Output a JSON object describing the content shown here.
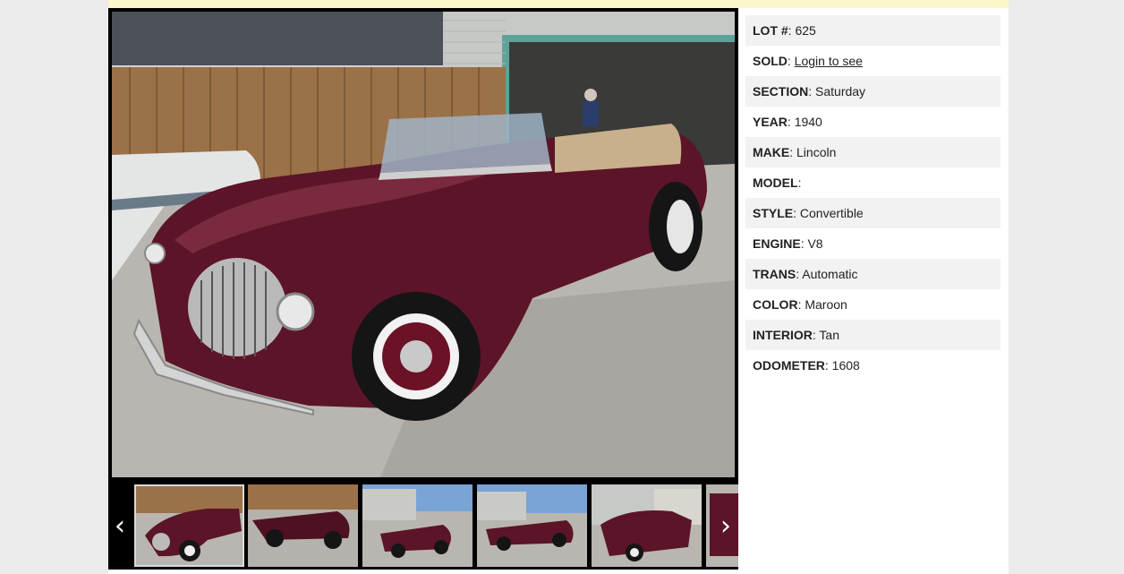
{
  "details": [
    {
      "key": "LOT #",
      "value": "625"
    },
    {
      "key": "SOLD",
      "value": "Login to see",
      "link": true
    },
    {
      "key": "SECTION",
      "value": "Saturday"
    },
    {
      "key": "YEAR",
      "value": "1940"
    },
    {
      "key": "MAKE",
      "value": "Lincoln"
    },
    {
      "key": "MODEL",
      "value": ""
    },
    {
      "key": "STYLE",
      "value": "Convertible"
    },
    {
      "key": "ENGINE",
      "value": "V8"
    },
    {
      "key": "TRANS",
      "value": "Automatic"
    },
    {
      "key": "COLOR",
      "value": "Maroon"
    },
    {
      "key": "INTERIOR",
      "value": "Tan"
    },
    {
      "key": "ODOMETER",
      "value": "1608"
    }
  ],
  "gallery": {
    "prev_icon": "chevron-left-icon",
    "next_icon": "chevron-right-icon",
    "prev_glyph": "‹",
    "next_glyph": "›",
    "thumbnail_count": 6,
    "active_thumbnail": 0
  },
  "colors": {
    "page_bg": "#ebebeb",
    "top_strip": "#fbf7c9",
    "row_alt": "#f2f2f2",
    "car": "#5c1428"
  }
}
